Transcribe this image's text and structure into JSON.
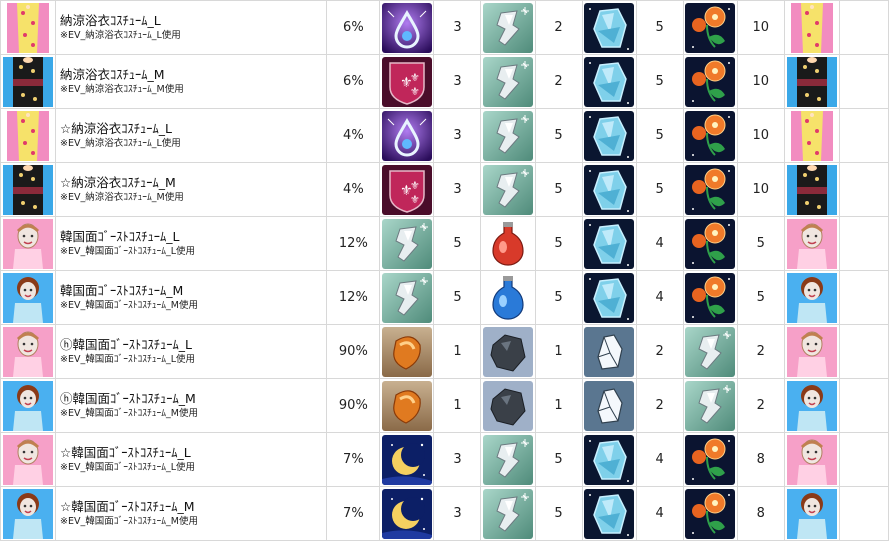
{
  "rows": [
    {
      "avatar": "yukata-pink-avatar-icon",
      "name": "納涼浴衣ｺｽﾁｭｰﾑ_L",
      "note": "※EV_納涼浴衣ｺｽﾁｭｰﾑ_L使用",
      "rate": "6%",
      "items": [
        {
          "icon": "purple-drop-icon",
          "count": "3"
        },
        {
          "icon": "silver-shard-icon",
          "count": "2"
        },
        {
          "icon": "ice-crystal-icon",
          "count": "5"
        },
        {
          "icon": "morning-glory-icon",
          "count": "10"
        }
      ],
      "result": "yukata-pink-avatar-icon"
    },
    {
      "avatar": "yukata-black-avatar-icon",
      "name": "納涼浴衣ｺｽﾁｭｰﾑ_M",
      "note": "※EV_納涼浴衣ｺｽﾁｭｰﾑ_M使用",
      "rate": "6%",
      "items": [
        {
          "icon": "fleur-crest-icon",
          "count": "3"
        },
        {
          "icon": "silver-shard-icon",
          "count": "2"
        },
        {
          "icon": "ice-crystal-icon",
          "count": "5"
        },
        {
          "icon": "morning-glory-icon",
          "count": "10"
        }
      ],
      "result": "yukata-black-avatar-icon"
    },
    {
      "avatar": "yukata-pink-avatar-icon",
      "name": "☆納涼浴衣ｺｽﾁｭｰﾑ_L",
      "note": "※EV_納涼浴衣ｺｽﾁｭｰﾑ_L使用",
      "rate": "4%",
      "items": [
        {
          "icon": "purple-drop-icon",
          "count": "3"
        },
        {
          "icon": "silver-shard-icon",
          "count": "5"
        },
        {
          "icon": "ice-crystal-icon",
          "count": "5"
        },
        {
          "icon": "morning-glory-icon",
          "count": "10"
        }
      ],
      "result": "yukata-pink-avatar-icon"
    },
    {
      "avatar": "yukata-black-avatar-icon",
      "name": "☆納涼浴衣ｺｽﾁｭｰﾑ_M",
      "note": "※EV_納涼浴衣ｺｽﾁｭｰﾑ_M使用",
      "rate": "4%",
      "items": [
        {
          "icon": "fleur-crest-icon",
          "count": "3"
        },
        {
          "icon": "silver-shard-icon",
          "count": "5"
        },
        {
          "icon": "ice-crystal-icon",
          "count": "5"
        },
        {
          "icon": "morning-glory-icon",
          "count": "10"
        }
      ],
      "result": "yukata-black-avatar-icon"
    },
    {
      "avatar": "ghost-pink-avatar-icon",
      "name": "韓国面ｺﾞｰｽﾄｺｽﾁｭｰﾑ_L",
      "note": "※EV_韓国面ｺﾞｰｽﾄｺｽﾁｭｰﾑ_L使用",
      "rate": "12%",
      "items": [
        {
          "icon": "silver-shard-icon",
          "count": "5"
        },
        {
          "icon": "red-potion-icon",
          "count": "5"
        },
        {
          "icon": "ice-crystal-icon",
          "count": "4"
        },
        {
          "icon": "morning-glory-icon",
          "count": "5"
        }
      ],
      "result": "ghost-pink-avatar-icon"
    },
    {
      "avatar": "ghost-blue-avatar-icon",
      "name": "韓国面ｺﾞｰｽﾄｺｽﾁｭｰﾑ_M",
      "note": "※EV_韓国面ｺﾞｰｽﾄｺｽﾁｭｰﾑ_M使用",
      "rate": "12%",
      "items": [
        {
          "icon": "silver-shard-icon",
          "count": "5"
        },
        {
          "icon": "blue-potion-icon",
          "count": "5"
        },
        {
          "icon": "ice-crystal-icon",
          "count": "4"
        },
        {
          "icon": "morning-glory-icon",
          "count": "5"
        }
      ],
      "result": "ghost-blue-avatar-icon"
    },
    {
      "avatar": "ghost-pink-avatar-icon",
      "name": "ⓗ韓国面ｺﾞｰｽﾄｺｽﾁｭｰﾑ_L",
      "note": "※EV_韓国面ｺﾞｰｽﾄｺｽﾁｭｰﾑ_L使用",
      "rate": "90%",
      "items": [
        {
          "icon": "copper-ore-icon",
          "count": "1"
        },
        {
          "icon": "dark-rock-icon",
          "count": "1"
        },
        {
          "icon": "white-crystal-icon",
          "count": "2"
        },
        {
          "icon": "silver-shard-icon",
          "count": "2"
        }
      ],
      "result": "ghost-pink-avatar-icon"
    },
    {
      "avatar": "ghost-blue-avatar-icon",
      "name": "ⓗ韓国面ｺﾞｰｽﾄｺｽﾁｭｰﾑ_M",
      "note": "※EV_韓国面ｺﾞｰｽﾄｺｽﾁｭｰﾑ_M使用",
      "rate": "90%",
      "items": [
        {
          "icon": "copper-ore-icon",
          "count": "1"
        },
        {
          "icon": "dark-rock-icon",
          "count": "1"
        },
        {
          "icon": "white-crystal-icon",
          "count": "2"
        },
        {
          "icon": "silver-shard-icon",
          "count": "2"
        }
      ],
      "result": "ghost-blue-avatar-icon"
    },
    {
      "avatar": "ghost-pink-avatar-icon",
      "name": "☆韓国面ｺﾞｰｽﾄｺｽﾁｭｰﾑ_L",
      "note": "※EV_韓国面ｺﾞｰｽﾄｺｽﾁｭｰﾑ_L使用",
      "rate": "7%",
      "items": [
        {
          "icon": "crescent-moon-icon",
          "count": "3"
        },
        {
          "icon": "silver-shard-icon",
          "count": "5"
        },
        {
          "icon": "ice-crystal-icon",
          "count": "4"
        },
        {
          "icon": "morning-glory-icon",
          "count": "8"
        }
      ],
      "result": "ghost-pink-avatar-icon"
    },
    {
      "avatar": "ghost-blue-avatar-icon",
      "name": "☆韓国面ｺﾞｰｽﾄｺｽﾁｭｰﾑ_M",
      "note": "※EV_韓国面ｺﾞｰｽﾄｺｽﾁｭｰﾑ_M使用",
      "rate": "7%",
      "items": [
        {
          "icon": "crescent-moon-icon",
          "count": "3"
        },
        {
          "icon": "silver-shard-icon",
          "count": "5"
        },
        {
          "icon": "ice-crystal-icon",
          "count": "4"
        },
        {
          "icon": "morning-glory-icon",
          "count": "8"
        }
      ],
      "result": "ghost-blue-avatar-icon"
    }
  ]
}
